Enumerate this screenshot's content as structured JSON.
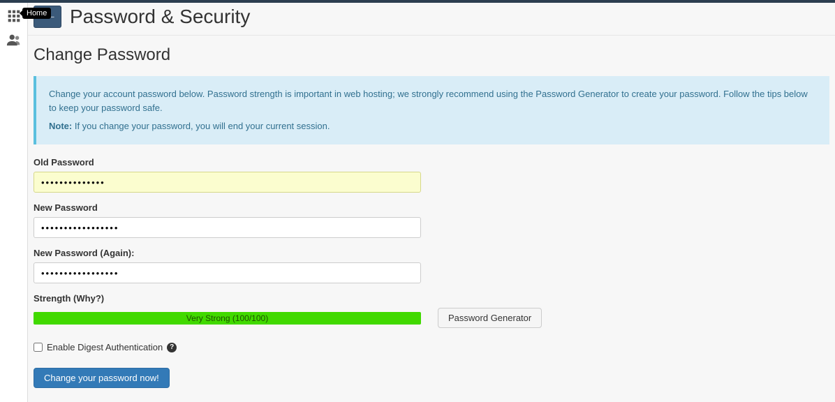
{
  "sidebar": {
    "tooltip_home": "Home"
  },
  "header": {
    "icon_text": "***–",
    "title": "Password & Security"
  },
  "section": {
    "title": "Change Password"
  },
  "banner": {
    "line1": "Change your account password below. Password strength is important in web hosting; we strongly recommend using the Password Generator to create your password. Follow the tips below to keep your password safe.",
    "note_label": "Note:",
    "note_text": " If you change your password, you will end your current session."
  },
  "form": {
    "old_password": {
      "label": "Old Password",
      "value": "••••••••••••••"
    },
    "new_password": {
      "label": "New Password",
      "value": "•••••••••••••••••"
    },
    "new_password_again": {
      "label": "New Password (Again):",
      "value": "•••••••••••••••••"
    },
    "strength": {
      "label": "Strength (Why?)",
      "text": "Very Strong (100/100)",
      "percent": 100
    },
    "generator_button": "Password Generator",
    "digest": {
      "label": "Enable Digest Authentication",
      "checked": false
    },
    "submit": "Change your password now!"
  }
}
